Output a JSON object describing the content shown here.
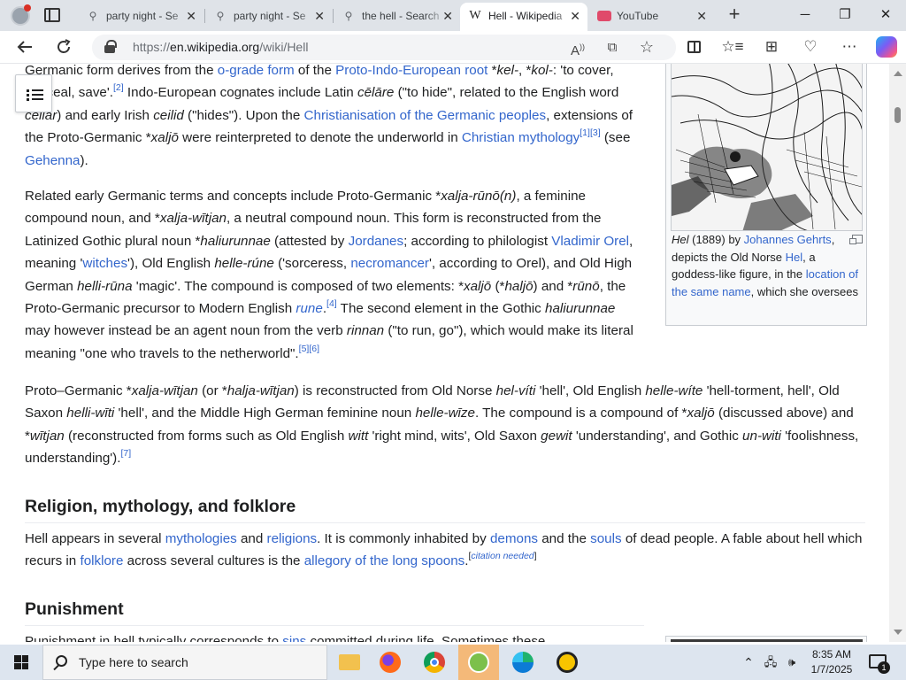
{
  "browser": {
    "tabs": [
      {
        "label": "party night - Se",
        "icon": "search-icon"
      },
      {
        "label": "party night - Se",
        "icon": "search-icon"
      },
      {
        "label": "the hell - Search",
        "icon": "search-icon"
      },
      {
        "label": "Hell - Wikipedia",
        "icon": "wikipedia-icon",
        "active": true
      },
      {
        "label": "YouTube",
        "icon": "youtube-icon"
      }
    ],
    "close_glyph": "✕",
    "new_tab_glyph": "+",
    "url_scheme": "https://",
    "url_host": "en.wikipedia.org",
    "url_path": "/wiki/Hell",
    "copilot_color": "#7b5cf5"
  },
  "article": {
    "para1": {
      "s1": "Germanic form derives from the ",
      "l1": "o-grade form",
      "s2": " of the ",
      "l2": "Proto-Indo-European root",
      "s3": " *",
      "i1": "kel-",
      "s4": ", *",
      "i2": "kol-",
      "s5": ": 'to cover, conceal, save'.",
      "r1": "[2]",
      "s6": " Indo-European cognates include Latin ",
      "i3": "cēlāre",
      "s7": " (\"to hide\", related to the English word ",
      "i4": "cellar",
      "s8": ") and early Irish ",
      "i5": "ceilid",
      "s9": " (\"hides\"). Upon the ",
      "l3": "Christianisation of the Germanic peoples",
      "s10": ", extensions of the Proto-Germanic *",
      "i6": "xaljō",
      "s11": " were reinterpreted to denote the underworld in ",
      "l4": "Christian mythology",
      "r2": "[1]",
      "r3": "[3]",
      "s12": " (see ",
      "l5": "Gehenna",
      "s13": ")."
    },
    "para2": {
      "s1": "Related early Germanic terms and concepts include Proto-Germanic *",
      "i1": "xalja-rūnō(n)",
      "s2": ", a feminine compound noun, and *",
      "i2": "xalja-wītjan",
      "s3": ", a neutral compound noun. This form is reconstructed from the Latinized Gothic plural noun *",
      "i3": "haliurunnae",
      "s4": " (attested by ",
      "l1": "Jordanes",
      "s5": "; according to philologist ",
      "l2": "Vladimir Orel",
      "s6": ", meaning '",
      "l3": "witches",
      "s7": "'), Old English ",
      "i4": "helle-rúne",
      "s8": " ('sorceress, ",
      "l4": "necromancer",
      "s9": "', according to Orel), and Old High German ",
      "i5": "helli-rūna",
      "s10": " 'magic'. The compound is composed of two elements: *",
      "i6": "xaljō",
      "s11": " (*",
      "i7": "haljō",
      "s12": ") and *",
      "i8": "rūnō",
      "s13": ", the Proto-Germanic precursor to Modern English ",
      "l5": "rune",
      "s14": ".",
      "r1": "[4]",
      "s15": " The second element in the Gothic ",
      "i9": "haliurunnae",
      "s16": " may however instead be an agent noun from the verb ",
      "i10": "rinnan",
      "s17": " (\"to run, go\"), which would make its literal meaning \"one who travels to the netherworld\".",
      "r2": "[5]",
      "r3": "[6]"
    },
    "para3": {
      "s1": "Proto–Germanic *",
      "i1": "xalja-wītjan",
      "s2": " (or *",
      "i2": "halja-wītjan",
      "s3": ") is reconstructed from Old Norse ",
      "i3": "hel-víti",
      "s4": " 'hell', Old English ",
      "i4": "helle-wíte",
      "s5": " 'hell-torment, hell', Old Saxon ",
      "i5": "helli-wīti",
      "s6": " 'hell', and the Middle High German feminine noun ",
      "i6": "helle-wīze",
      "s7": ". The compound is a compound of *",
      "i7": "xaljō",
      "s8": " (discussed above) and *",
      "i8": "wītjan",
      "s9": " (reconstructed from forms such as Old English ",
      "i9": "witt",
      "s10": " 'right mind, wits', Old Saxon ",
      "i10": "gewit",
      "s11": " 'understanding', and Gothic ",
      "i11": "un-witi",
      "s12": " 'foolishness, understanding').",
      "r1": "[7]"
    },
    "heading_religion": "Religion, mythology, and folklore",
    "para4": {
      "s1": "Hell appears in several ",
      "l1": "mythologies",
      "s2": " and ",
      "l2": "religions",
      "s3": ". It is commonly inhabited by ",
      "l3": "demons",
      "s4": " and the ",
      "l4": "souls",
      "s5": " of dead people. A fable about hell which recurs in ",
      "l5": "folklore",
      "s6": " across several cultures is the ",
      "l6": "allegory of the long spoons",
      "s7": ".",
      "r_open": "[",
      "r_text": "citation needed",
      "r_close": "]"
    },
    "heading_punishment": "Punishment",
    "para5": {
      "s1": "Punishment in hell typically corresponds to ",
      "l1": "sins",
      "s2": " committed during life. Sometimes these"
    }
  },
  "figure": {
    "cap_i1": "Hel",
    "cap_s1": " (1889) by ",
    "cap_l1": "Johannes Gehrts",
    "cap_s2": ", depicts the Old Norse ",
    "cap_l2": "Hel",
    "cap_s3": ", a goddess-like figure, in the ",
    "cap_l3": "location of the same name",
    "cap_s4": ", which she oversees"
  },
  "taskbar": {
    "search_placeholder": "Type here to search",
    "time": "8:35 AM",
    "date": "1/7/2025",
    "notification_count": "1",
    "apps": [
      "file-explorer",
      "firefox",
      "chrome",
      "sync-app",
      "edge",
      "norton"
    ]
  }
}
